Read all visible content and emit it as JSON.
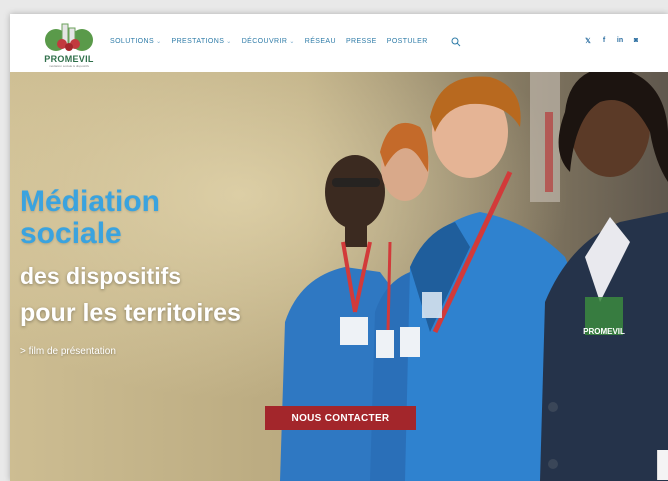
{
  "brand": {
    "name": "PROMEVIL",
    "tagline": "médiation sociale & dispositifs",
    "colors": {
      "primary": "#3aa3df",
      "green": "#2f6f4a",
      "red": "#a3262b"
    }
  },
  "nav": {
    "items": [
      {
        "label": "SOLUTIONS",
        "has_dropdown": true
      },
      {
        "label": "PRESTATIONS",
        "has_dropdown": true
      },
      {
        "label": "DÉCOUVRIR",
        "has_dropdown": true
      },
      {
        "label": "RÉSEAU",
        "has_dropdown": false
      },
      {
        "label": "PRESSE",
        "has_dropdown": false
      },
      {
        "label": "POSTULER",
        "has_dropdown": false
      }
    ],
    "chevron": "⌄",
    "search_icon": "search-icon"
  },
  "social": [
    {
      "icon": "twitter-icon",
      "glyph": "𝕏"
    },
    {
      "icon": "facebook-icon",
      "glyph": "f"
    },
    {
      "icon": "linkedin-icon",
      "glyph": "in"
    },
    {
      "icon": "instagram-icon",
      "glyph": "◙"
    }
  ],
  "hero": {
    "title_line1": "Médiation",
    "title_line2": "sociale",
    "subtitle_line1": "des dispositifs",
    "subtitle_line2": "pour les territoires",
    "film_link": "> film de présentation",
    "cta_label": "NOUS CONTACTER",
    "jacket_logo_text": "PROMEVIL"
  }
}
